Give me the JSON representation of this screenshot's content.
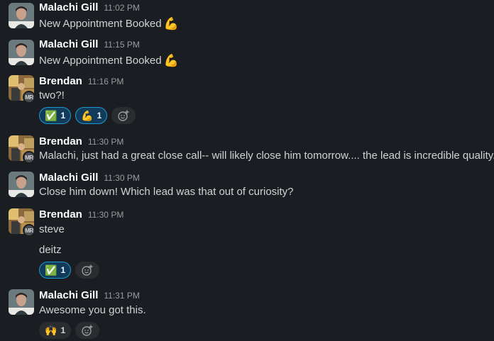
{
  "messages": [
    {
      "author": "Malachi Gill",
      "time": "11:02 PM",
      "lines": [
        "New Appointment Booked"
      ],
      "emoji": "💪"
    },
    {
      "author": "Malachi Gill",
      "time": "11:15 PM",
      "lines": [
        "New Appointment Booked"
      ],
      "emoji": "💪"
    },
    {
      "author": "Brendan",
      "time": "11:16 PM",
      "avatar_badge": "MR",
      "lines": [
        "two?!"
      ],
      "reactions": [
        {
          "icon": "✅",
          "count": "1"
        },
        {
          "icon": "💪",
          "count": "1"
        }
      ]
    },
    {
      "author": "Brendan",
      "time": "11:30 PM",
      "avatar_badge": "MR",
      "lines": [
        "Malachi, just had a great close call-- will likely close him tomorrow.... the lead is incredible quality."
      ]
    },
    {
      "author": "Malachi Gill",
      "time": "11:30 PM",
      "lines": [
        "Close him down! Which lead was that out of curiosity?"
      ]
    },
    {
      "author": "Brendan",
      "time": "11:30 PM",
      "avatar_badge": "MR",
      "lines": [
        "steve",
        "deitz"
      ],
      "reactions": [
        {
          "icon": "✅",
          "count": "1"
        }
      ]
    },
    {
      "author": "Malachi Gill",
      "time": "11:31 PM",
      "lines": [
        "Awesome you got this."
      ],
      "reactions": [
        {
          "icon": "🙌",
          "count": "1"
        }
      ]
    }
  ],
  "colors": {
    "background": "#1a1d21",
    "author": "#ffffff",
    "text": "#d1d2d3",
    "timestamp": "#9a9b9e",
    "reaction_selected_bg": "#123a5a",
    "reaction_selected_border": "#1d9bd1"
  }
}
